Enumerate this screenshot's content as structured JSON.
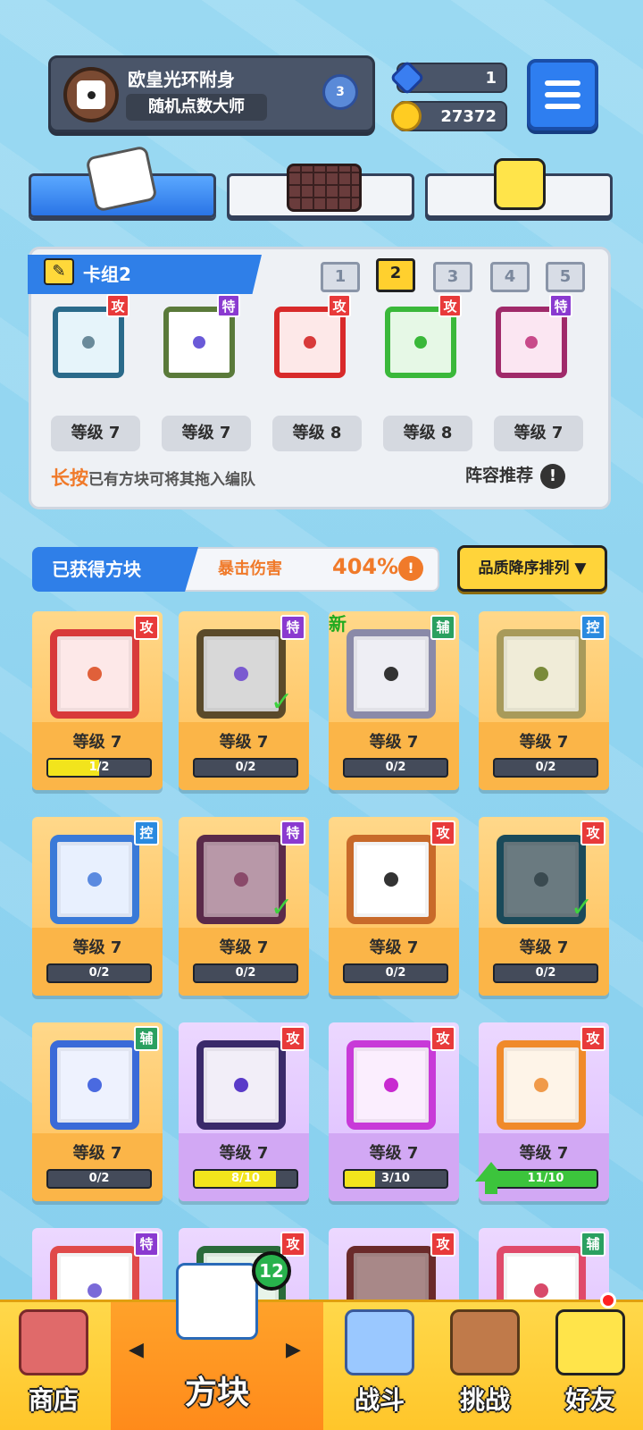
{
  "profile": {
    "name": "欧皇光环附身",
    "title": "随机点数大师",
    "rank": "3"
  },
  "resources": {
    "gems": "1",
    "coins": "27372"
  },
  "deck": {
    "title": "卡组2",
    "numbers": [
      "1",
      "2",
      "3",
      "4",
      "5"
    ],
    "selected": "2",
    "slots": [
      {
        "tag": "攻",
        "level": "等级 7"
      },
      {
        "tag": "特",
        "level": "等级 7"
      },
      {
        "tag": "攻",
        "level": "等级 8"
      },
      {
        "tag": "攻",
        "level": "等级 8"
      },
      {
        "tag": "特",
        "level": "等级 7"
      }
    ],
    "hint_key": "长按",
    "hint_text": "已有方块可将其拖入编队",
    "recommend": "阵容推荐"
  },
  "owned": {
    "title": "已获得方块",
    "crit_label": "暴击伤害",
    "crit_value": "404%",
    "sort_label": "品质降序排列 ▼"
  },
  "cards": [
    {
      "tag": "攻",
      "level": "等级 7",
      "progress": "1/2",
      "fill": 0.5
    },
    {
      "tag": "特",
      "level": "等级 7",
      "progress": "0/2",
      "fill": 0
    },
    {
      "tag": "辅",
      "level": "等级 7",
      "progress": "0/2",
      "fill": 0,
      "new": "新"
    },
    {
      "tag": "控",
      "level": "等级 7",
      "progress": "0/2",
      "fill": 0
    },
    {
      "tag": "控",
      "level": "等级 7",
      "progress": "0/2",
      "fill": 0
    },
    {
      "tag": "特",
      "level": "等级 7",
      "progress": "0/2",
      "fill": 0
    },
    {
      "tag": "攻",
      "level": "等级 7",
      "progress": "0/2",
      "fill": 0
    },
    {
      "tag": "攻",
      "level": "等级 7",
      "progress": "0/2",
      "fill": 0
    },
    {
      "tag": "辅",
      "level": "等级 7",
      "progress": "0/2",
      "fill": 0
    },
    {
      "tag": "攻",
      "level": "等级 7",
      "progress": "8/10",
      "fill": 0.8
    },
    {
      "tag": "攻",
      "level": "等级 7",
      "progress": "3/10",
      "fill": 0.3
    },
    {
      "tag": "攻",
      "level": "等级 7",
      "progress": "11/10",
      "fill": 1.0
    },
    {
      "tag": "特"
    },
    {
      "tag": "攻"
    },
    {
      "tag": "攻"
    },
    {
      "tag": "辅"
    }
  ],
  "nav": {
    "shop": "商店",
    "blocks": "方块",
    "battle": "战斗",
    "challenge": "挑战",
    "friends": "好友",
    "badge": "12",
    "prev": "◀",
    "next": "▶"
  },
  "colors": {
    "accent_blue": "#2f7fe8",
    "gold": "#ffd43a",
    "attack": "#e83a3a",
    "special": "#8a3ad0",
    "support": "#2aa060",
    "control": "#2a8ae0"
  }
}
